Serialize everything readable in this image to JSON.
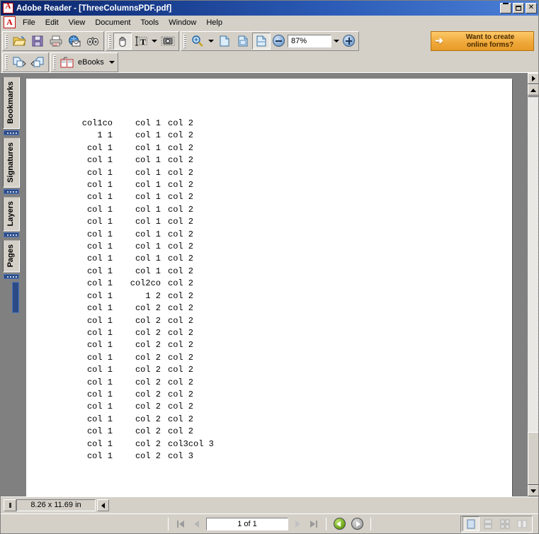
{
  "window": {
    "title": "Adobe Reader - [ThreeColumnsPDF.pdf]",
    "app_icon": "adobe-reader-icon",
    "minimize_label": "_",
    "maximize_label": "□",
    "close_label": "✕"
  },
  "menu": {
    "items": [
      {
        "label": "File"
      },
      {
        "label": "Edit"
      },
      {
        "label": "View"
      },
      {
        "label": "Document"
      },
      {
        "label": "Tools"
      },
      {
        "label": "Window"
      },
      {
        "label": "Help"
      }
    ]
  },
  "toolbar": {
    "file_group": [
      {
        "name": "open-icon",
        "title": "Open"
      },
      {
        "name": "save-icon",
        "title": "Save"
      },
      {
        "name": "print-icon",
        "title": "Print"
      },
      {
        "name": "email-icon",
        "title": "Email"
      },
      {
        "name": "search-icon",
        "title": "Search"
      }
    ],
    "tools_group": [
      {
        "name": "hand-tool-icon",
        "title": "Hand Tool"
      },
      {
        "name": "select-text-icon",
        "title": "Select Text"
      },
      {
        "name": "snapshot-icon",
        "title": "Snapshot Tool"
      }
    ],
    "zoom_group": {
      "zoom_in_icon": "zoom-tool-icon",
      "actual_size_icon": "actual-size-icon",
      "fit-page_icon": "fit-page-icon",
      "fit-width_icon": "fit-width-icon",
      "zoom_out_button": "zoom-out-icon",
      "zoom_value": "87%",
      "zoom_in_button": "zoom-in-icon"
    },
    "second_row": {
      "prev_view_icon": "previous-view-icon",
      "next_view_icon": "next-view-icon",
      "ebooks_label": "eBooks",
      "ebooks_icon": "ebooks-icon"
    },
    "promo": {
      "line1": "Want to create",
      "line2": "online forms?",
      "arrow_icon": "cursor-arrow-icon",
      "color": "#f0a93b"
    }
  },
  "navpane": {
    "tabs": [
      {
        "label": "Bookmarks"
      },
      {
        "label": "Signatures"
      },
      {
        "label": "Layers"
      },
      {
        "label": "Pages"
      }
    ]
  },
  "document": {
    "columns": [
      "col 1",
      "col 2",
      "col 3"
    ],
    "rows": [
      [
        "col1co",
        "col 1",
        "col 2"
      ],
      [
        "1 1",
        "col 1",
        "col 2"
      ],
      [
        "col 1",
        "col 1",
        "col 2"
      ],
      [
        "col 1",
        "col 1",
        "col 2"
      ],
      [
        "col 1",
        "col 1",
        "col 2"
      ],
      [
        "col 1",
        "col 1",
        "col 2"
      ],
      [
        "col 1",
        "col 1",
        "col 2"
      ],
      [
        "col 1",
        "col 1",
        "col 2"
      ],
      [
        "col 1",
        "col 1",
        "col 2"
      ],
      [
        "col 1",
        "col 1",
        "col 2"
      ],
      [
        "col 1",
        "col 1",
        "col 2"
      ],
      [
        "col 1",
        "col 1",
        "col 2"
      ],
      [
        "col 1",
        "col 1",
        "col 2"
      ],
      [
        "col 1",
        "col2co",
        "col 2"
      ],
      [
        "col 1",
        "1 2",
        "col 2"
      ],
      [
        "col 1",
        "col 2",
        "col 2"
      ],
      [
        "col 1",
        "col 2",
        "col 2"
      ],
      [
        "col 1",
        "col 2",
        "col 2"
      ],
      [
        "col 1",
        "col 2",
        "col 2"
      ],
      [
        "col 1",
        "col 2",
        "col 2"
      ],
      [
        "col 1",
        "col 2",
        "col 2"
      ],
      [
        "col 1",
        "col 2",
        "col 2"
      ],
      [
        "col 1",
        "col 2",
        "col 2"
      ],
      [
        "col 1",
        "col 2",
        "col 2"
      ],
      [
        "col 1",
        "col 2",
        "col 2"
      ],
      [
        "col 1",
        "col 2",
        "col 2"
      ],
      [
        "col 1",
        "col 2",
        "col3col 3"
      ],
      [
        "col 1",
        "col 2",
        "col 3"
      ]
    ]
  },
  "statusbar": {
    "page_size": "8.26 x 11.69 in",
    "resize_grip_icon": "horizontal-resize-icon",
    "expand_icon": "expand-arrow-icon"
  },
  "bottombar": {
    "first_page_icon": "first-page-icon",
    "prev_page_icon": "previous-page-icon",
    "page_indicator": "1 of 1",
    "next_page_icon": "next-page-icon",
    "last_page_icon": "last-page-icon",
    "back_icon": "go-back-icon",
    "forward_icon": "go-forward-icon",
    "layout_buttons": [
      {
        "name": "single-page-layout-icon",
        "selected": true
      },
      {
        "name": "continuous-layout-icon",
        "selected": false
      },
      {
        "name": "facing-layout-icon",
        "selected": false
      },
      {
        "name": "continuous-facing-layout-icon",
        "selected": false
      }
    ]
  }
}
